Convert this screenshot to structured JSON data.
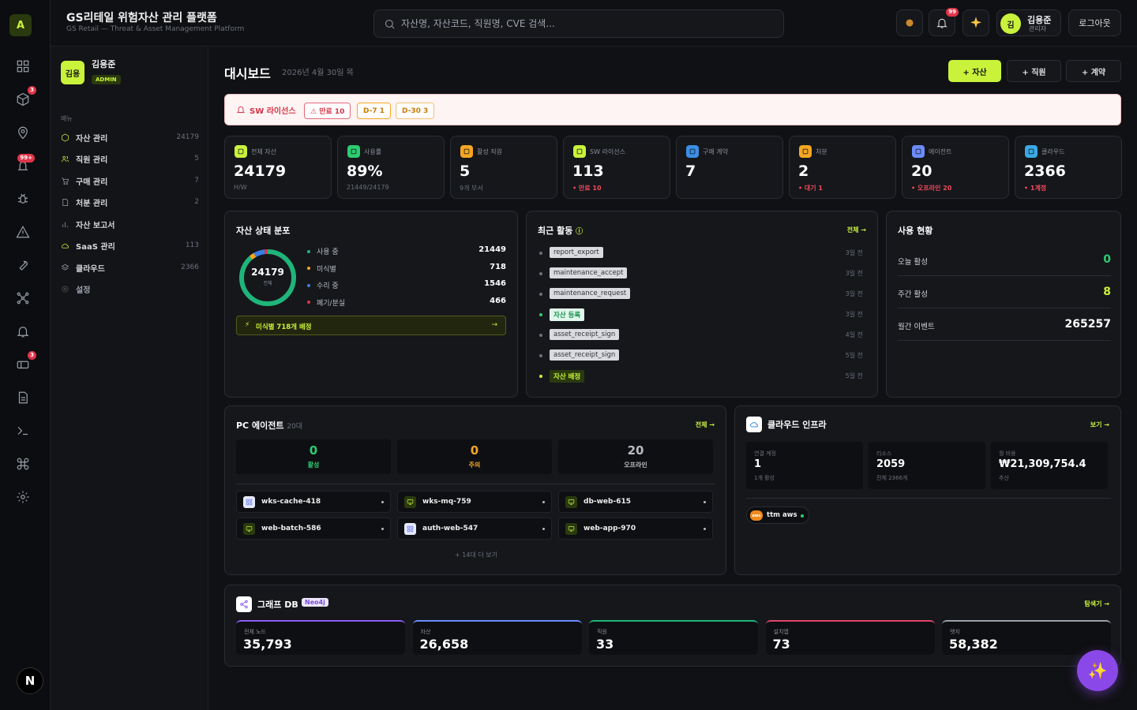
{
  "app": {
    "logo": "A",
    "title": "GS리테일 위험자산 관리 플랫폼",
    "subtitle": "GS Retail — Threat & Asset Management Platform"
  },
  "search": {
    "placeholder": "자산명, 자산코드, 직원명, CVE 검색..."
  },
  "topbar": {
    "notif_badge": "99",
    "user_avatar": "김",
    "user_name": "김용준",
    "user_role": "관리자",
    "logout": "로그아웃"
  },
  "rail": {
    "badges": {
      "assets": "3",
      "alerts": "99+",
      "contracts": "3"
    }
  },
  "sidebar": {
    "avatar": "김용",
    "name": "김용준",
    "role": "ADMIN",
    "section": "메뉴",
    "items": [
      {
        "label": "자산 관리",
        "count": "24179",
        "icon": "cube-icon"
      },
      {
        "label": "직원 관리",
        "count": "5",
        "icon": "users-icon"
      },
      {
        "label": "구매 관리",
        "count": "7",
        "icon": "cart-icon"
      },
      {
        "label": "처분 관리",
        "count": "2",
        "icon": "doc-icon"
      },
      {
        "label": "자산 보고서",
        "count": "",
        "icon": "bar-chart-icon"
      },
      {
        "label": "SaaS 관리",
        "count": "113",
        "icon": "cloud-icon"
      },
      {
        "label": "클라우드",
        "count": "2366",
        "icon": "layers-icon"
      },
      {
        "label": "설정",
        "count": "",
        "icon": "gear-icon"
      }
    ]
  },
  "page": {
    "title": "대시보드",
    "date": "2026년 4월 30일 목",
    "actions": {
      "asset": "+ 자산",
      "employee": "+ 직원",
      "contract": "+ 계약"
    }
  },
  "alert": {
    "title": "SW 라이선스",
    "chips": [
      "⚠ 만료 10",
      "D-7 1",
      "D-30 3"
    ]
  },
  "kpis": [
    {
      "label": "전체 자산",
      "value": "24179",
      "sub": "H/W",
      "sub_red": false,
      "color": "#c9f23b"
    },
    {
      "label": "사용률",
      "value": "89%",
      "sub": "21449/24179",
      "sub_red": false,
      "color": "#2ecc71"
    },
    {
      "label": "활성 직원",
      "value": "5",
      "sub": "9개 부서",
      "sub_red": false,
      "color": "#f5a623"
    },
    {
      "label": "SW 라이선스",
      "value": "113",
      "sub": "• 만료 10",
      "sub_red": true,
      "color": "#c9f23b"
    },
    {
      "label": "구매 계약",
      "value": "7",
      "sub": "",
      "sub_red": false,
      "color": "#3a8ee6"
    },
    {
      "label": "처분",
      "value": "2",
      "sub": "• 대기 1",
      "sub_red": true,
      "color": "#f5a623"
    },
    {
      "label": "에이전트",
      "value": "20",
      "sub": "• 오프라인 20",
      "sub_red": true,
      "color": "#6b8cff"
    },
    {
      "label": "클라우드",
      "value": "2366",
      "sub": "• 1계정",
      "sub_red": true,
      "color": "#3aa8e6"
    }
  ],
  "asset_status": {
    "title": "자산 상태 분포",
    "total": "24179",
    "total_label": "전체",
    "items": [
      {
        "label": "사용 중",
        "value": "21449",
        "color": "#1fb57a"
      },
      {
        "label": "미식별",
        "value": "718",
        "color": "#f5a623"
      },
      {
        "label": "수리 중",
        "value": "1546",
        "color": "#3a7ee6"
      },
      {
        "label": "폐기/분실",
        "value": "466",
        "color": "#e0354a"
      }
    ],
    "notice": "미식별 718개 배정"
  },
  "recent": {
    "title": "최근 활동",
    "link": "전체 →",
    "items": [
      {
        "tag": "report_export",
        "time": "3일 전",
        "style": "gray"
      },
      {
        "tag": "maintenance_accept",
        "time": "3일 전",
        "style": "gray"
      },
      {
        "tag": "maintenance_request",
        "time": "3일 전",
        "style": "gray"
      },
      {
        "tag": "자산 등록",
        "time": "3일 전",
        "style": "green"
      },
      {
        "tag": "asset_receipt_sign",
        "time": "4일 전",
        "style": "gray"
      },
      {
        "tag": "asset_receipt_sign",
        "time": "5일 전",
        "style": "gray"
      },
      {
        "tag": "자산 배정",
        "time": "5일 전",
        "style": "lime"
      }
    ]
  },
  "usage": {
    "title": "사용 현황",
    "rows": [
      {
        "label": "오늘 활성",
        "value": "0",
        "color": "#2ecc71"
      },
      {
        "label": "주간 활성",
        "value": "8",
        "color": "#c9f23b"
      },
      {
        "label": "월간 이벤트",
        "value": "265257",
        "color": "#ffffff"
      }
    ]
  },
  "pc_agents": {
    "title": "PC 에이전트",
    "count": "20대",
    "link": "전체 →",
    "stats": [
      {
        "value": "0",
        "label": "활성",
        "color": "#2ecc71"
      },
      {
        "value": "0",
        "label": "주의",
        "color": "#f5a623"
      },
      {
        "value": "20",
        "label": "오프라인",
        "color": "#b7bbc2"
      }
    ],
    "agents": [
      {
        "name": "wks-cache-418",
        "kind": "grid"
      },
      {
        "name": "wks-mq-759",
        "kind": "monitor"
      },
      {
        "name": "db-web-615",
        "kind": "monitor"
      },
      {
        "name": "web-batch-586",
        "kind": "monitor"
      },
      {
        "name": "auth-web-547",
        "kind": "grid"
      },
      {
        "name": "web-app-970",
        "kind": "monitor"
      }
    ],
    "more": "+ 14대 더 보기"
  },
  "cloud": {
    "title": "클라우드 인프라",
    "link": "보기 →",
    "stats": [
      {
        "label": "연결 계정",
        "value": "1",
        "sub": "1개 활성"
      },
      {
        "label": "리소스",
        "value": "2059",
        "sub": "전체 2366개"
      },
      {
        "label": "월 비용",
        "value": "₩21,309,754.4",
        "sub": "추산"
      }
    ],
    "account_badge": "aws",
    "account": "ttm aws"
  },
  "graph": {
    "title": "그래프 DB",
    "badge": "Neo4j",
    "link": "탐색기 →",
    "stats": [
      {
        "label": "전체 노드",
        "value": "35,793",
        "color": "#8b5cf6"
      },
      {
        "label": "자산",
        "value": "26,658",
        "color": "#6b8cff"
      },
      {
        "label": "직원",
        "value": "33",
        "color": "#1fb57a"
      },
      {
        "label": "설치앱",
        "value": "73",
        "color": "#e0456a"
      },
      {
        "label": "엣지",
        "value": "58,382",
        "color": "#9aa0aa"
      }
    ]
  },
  "fab": "✨",
  "nextjs": "N"
}
